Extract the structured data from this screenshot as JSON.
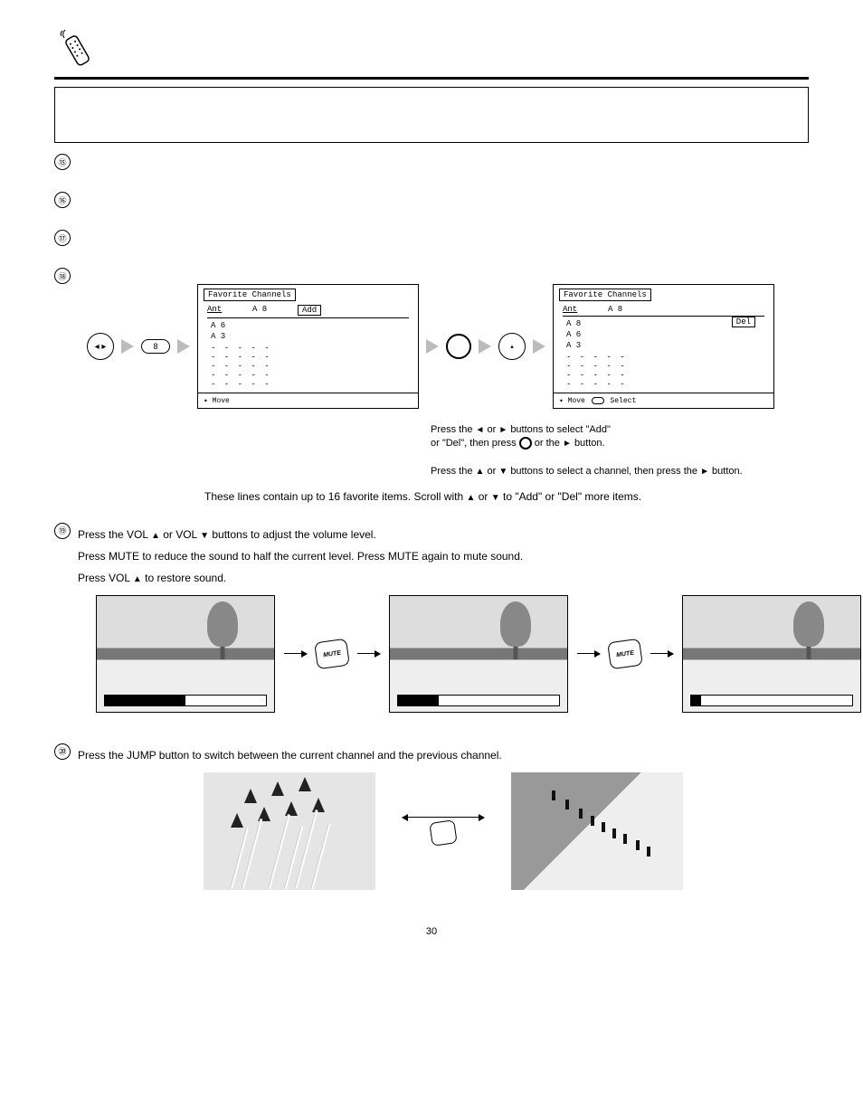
{
  "items": {
    "n15": "⑮",
    "n16": "⑯",
    "n17": "⑰",
    "n18": "⑱",
    "n19": "⑲",
    "n20": "⑳"
  },
  "menu1": {
    "title": "Favorite Channels",
    "head": {
      "a": "Ant",
      "b": "A 8",
      "c": "Add"
    },
    "rows": [
      "A 6",
      "A 3"
    ],
    "dots": "- - - - -",
    "footer": {
      "move": "Move"
    }
  },
  "menu2": {
    "title": "Favorite Channels",
    "head": {
      "a": "Ant",
      "b": "A 8"
    },
    "rows": [
      "A 8",
      "A 6",
      "A 3"
    ],
    "del": "Del",
    "dots": "- - - - -",
    "footer": {
      "move": "Move",
      "select": "Select"
    }
  },
  "button": {
    "eight": "8"
  },
  "captions": {
    "c1a": "Press the",
    "c1b": "or",
    "c1c": "buttons to select \"Add\"",
    "c1d": "or \"Del\", then press",
    "c1e": "or the",
    "c1f": "button.",
    "c2a": "Press the",
    "c2b": "or",
    "c2c": "buttons to select a channel, then press the",
    "c2d": "button.",
    "c3a": "These lines contain up to 16 favorite items. Scroll with",
    "c3b": "or",
    "c3c": "to \"Add\" or \"Del\" more items."
  },
  "item19": {
    "a": "Press the VOL",
    "b": "or VOL",
    "c": "buttons to adjust the volume level.",
    "d": "Press MUTE to reduce the sound to half the current level. Press MUTE again to mute sound.",
    "e": "Press VOL",
    "f": "to restore sound."
  },
  "mute": "MUTE",
  "item20": {
    "a": "Press the JUMP button to switch between the current channel and the previous channel."
  },
  "page": "30"
}
